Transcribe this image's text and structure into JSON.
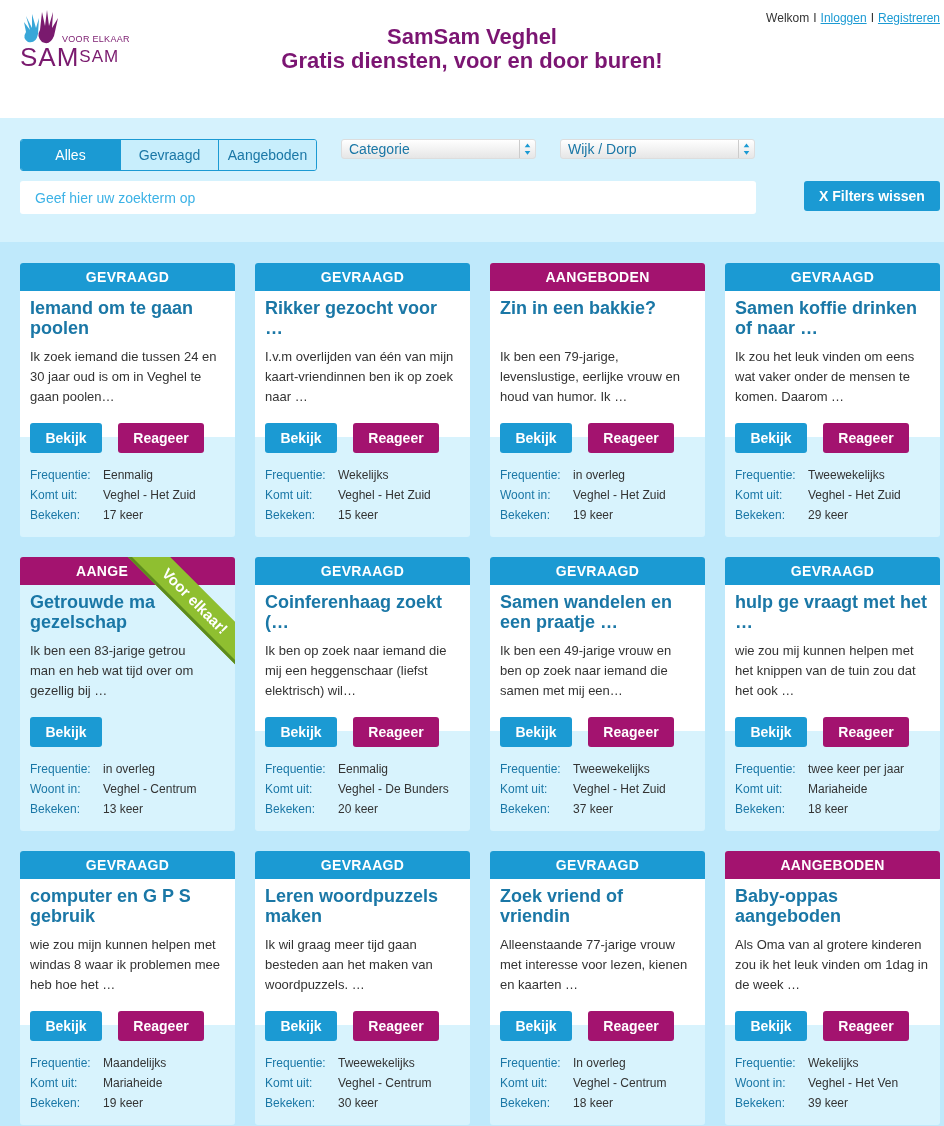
{
  "logo": {
    "tagline": "VOOR ELKAAR",
    "name_parts": [
      "SAM",
      "SAM"
    ]
  },
  "title": "SamSam Veghel",
  "subtitle": "Gratis diensten, voor en door buren!",
  "user_nav": {
    "greeting": "Welkom",
    "links": [
      "Inloggen",
      "Registreren"
    ],
    "separators": [
      "I",
      "I"
    ]
  },
  "filters": {
    "tabs": [
      {
        "label": "Alles",
        "selected": true
      },
      {
        "label": "Gevraagd",
        "selected": false
      },
      {
        "label": "Aangeboden",
        "selected": false
      }
    ],
    "selects": [
      "Categorie",
      "Wijk / Dorp"
    ],
    "search": {
      "placeholder": "Geef hier uw zoekterm op"
    },
    "clear_button": "X Filters wissen"
  },
  "cards": [
    {
      "color": "#1b9ad3",
      "badge": "GEVRAAGD",
      "title": "Iemand om te gaan poolen",
      "description": "Ik zoek iemand die tussen 24 en 30 jaar oud is om in Veghel te gaan poolen…",
      "buttons": [
        "Bekijk",
        "Reageer"
      ],
      "details": [
        [
          "Frequentie:",
          "Eenmalig"
        ],
        [
          "Komt uit:",
          "Veghel - Het Zuid"
        ],
        [
          "Bekeken:",
          "17 keer"
        ]
      ]
    },
    {
      "color": "#1b9ad3",
      "badge": "GEVRAAGD",
      "title": "Rikker gezocht voor …",
      "description": "I.v.m overlijden van één van mijn kaart-vriendinnen ben ik op zoek naar …",
      "buttons": [
        "Bekijk",
        "Reageer"
      ],
      "details": [
        [
          "Frequentie:",
          "Wekelijks"
        ],
        [
          "Komt uit:",
          "Veghel - Het Zuid"
        ],
        [
          "Bekeken:",
          "15 keer"
        ]
      ]
    },
    {
      "color": "#a3136f",
      "badge": "AANGEBODEN",
      "title": "Zin in een bakkie?",
      "description": "Ik ben een 79-jarige, levenslustige, eerlijke vrouw en houd van humor. Ik …",
      "buttons": [
        "Bekijk",
        "Reageer"
      ],
      "details": [
        [
          "Frequentie:",
          "in overleg"
        ],
        [
          "Woont in:",
          "Veghel - Het Zuid"
        ],
        [
          "Bekeken:",
          "19 keer"
        ]
      ]
    },
    {
      "color": "#1b9ad3",
      "badge": "GEVRAAGD",
      "title": "Samen koffie drinken of naar …",
      "description": "Ik zou het leuk vinden om eens wat vaker onder de mensen te komen. Daarom …",
      "buttons": [
        "Bekijk",
        "Reageer"
      ],
      "details": [
        [
          "Frequentie:",
          "Tweewekelijks"
        ],
        [
          "Komt uit:",
          "Veghel - Het Zuid"
        ],
        [
          "Bekeken:",
          "29 keer"
        ]
      ]
    },
    {
      "color": "#a3136f",
      "badge": "AANGE",
      "ribbon": "Voor elkaar!",
      "title_lines": [
        "Getrouwde ma",
        "gezelschap"
      ],
      "description_lines": [
        "Ik ben een 83-jarige getrou",
        "man en heb wat tijd over om",
        "gezellig bij …"
      ],
      "buttons": [
        "Bekijk"
      ],
      "details": [
        [
          "Frequentie:",
          "in overleg"
        ],
        [
          "Woont in:",
          "Veghel - Centrum"
        ],
        [
          "Bekeken:",
          "13 keer"
        ]
      ]
    },
    {
      "color": "#1b9ad3",
      "badge": "GEVRAAGD",
      "title": "Coinferenhaag zoekt (…",
      "description": "Ik ben op zoek naar iemand die mij een heggenschaar (liefst elektrisch) wil…",
      "buttons": [
        "Bekijk",
        "Reageer"
      ],
      "details": [
        [
          "Frequentie:",
          "Eenmalig"
        ],
        [
          "Komt uit:",
          "Veghel - De Bunders"
        ],
        [
          "Bekeken:",
          "20 keer"
        ]
      ]
    },
    {
      "color": "#1b9ad3",
      "badge": "GEVRAAGD",
      "title": "Samen wandelen en een praatje …",
      "description": "Ik ben een 49-jarige vrouw en ben op zoek naar iemand die samen met mij een…",
      "buttons": [
        "Bekijk",
        "Reageer"
      ],
      "details": [
        [
          "Frequentie:",
          "Tweewekelijks"
        ],
        [
          "Komt uit:",
          "Veghel - Het Zuid"
        ],
        [
          "Bekeken:",
          "37 keer"
        ]
      ]
    },
    {
      "color": "#1b9ad3",
      "badge": "GEVRAAGD",
      "title": "hulp ge vraagt met het …",
      "description": "wie zou mij kunnen helpen met het knippen van de tuin zou dat het ook …",
      "buttons": [
        "Bekijk",
        "Reageer"
      ],
      "details": [
        [
          "Frequentie:",
          "twee keer per jaar"
        ],
        [
          "Komt uit:",
          "Mariaheide"
        ],
        [
          "Bekeken:",
          "18 keer"
        ]
      ]
    },
    {
      "color": "#1b9ad3",
      "badge": "GEVRAAGD",
      "title": "computer en G P S gebruik",
      "description": "wie zou mijn kunnen helpen met windas 8 waar ik problemen mee heb hoe het …",
      "buttons": [
        "Bekijk",
        "Reageer"
      ],
      "details": [
        [
          "Frequentie:",
          "Maandelijks"
        ],
        [
          "Komt uit:",
          "Mariaheide"
        ],
        [
          "Bekeken:",
          "19 keer"
        ]
      ]
    },
    {
      "color": "#1b9ad3",
      "badge": "GEVRAAGD",
      "title": "Leren woordpuzzels maken",
      "description": "Ik wil graag meer tijd gaan besteden aan het maken van woordpuzzels. …",
      "buttons": [
        "Bekijk",
        "Reageer"
      ],
      "details": [
        [
          "Frequentie:",
          "Tweewekelijks"
        ],
        [
          "Komt uit:",
          "Veghel - Centrum"
        ],
        [
          "Bekeken:",
          "30 keer"
        ]
      ]
    },
    {
      "color": "#1b9ad3",
      "badge": "GEVRAAGD",
      "title": "Zoek vriend of vriendin",
      "description": "Alleenstaande 77-jarige vrouw met interesse voor lezen, kienen en kaarten …",
      "buttons": [
        "Bekijk",
        "Reageer"
      ],
      "details": [
        [
          "Frequentie:",
          "In overleg"
        ],
        [
          "Komt uit:",
          "Veghel - Centrum"
        ],
        [
          "Bekeken:",
          "18 keer"
        ]
      ]
    },
    {
      "color": "#a3136f",
      "badge": "AANGEBODEN",
      "title": "Baby-oppas aangeboden",
      "description": "Als Oma van al grotere kinderen zou ik het leuk vinden om 1dag in de week …",
      "buttons": [
        "Bekijk",
        "Reageer"
      ],
      "details": [
        [
          "Frequentie:",
          "Wekelijks"
        ],
        [
          "Woont in:",
          "Veghel - Het Ven"
        ],
        [
          "Bekeken:",
          "39 keer"
        ]
      ]
    }
  ]
}
